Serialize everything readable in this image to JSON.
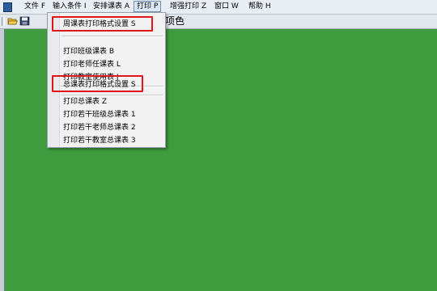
{
  "menubar": {
    "items": [
      {
        "label": "文件 F"
      },
      {
        "label": "输入条件 I"
      },
      {
        "label": "安排课表 A"
      },
      {
        "label": "打印 P"
      },
      {
        "label": "增强打印 Z"
      },
      {
        "label": "窗口 W"
      },
      {
        "label": "帮助 H"
      }
    ],
    "active_index": 3
  },
  "toolbar": {
    "buttons": [
      {
        "icon": "open-folder-icon"
      },
      {
        "icon": "save-disk-icon"
      }
    ],
    "visible_text": "项色"
  },
  "print_menu": {
    "groups": [
      {
        "items": [
          {
            "label": "周课表打印格式设置 S",
            "highlighted": true
          }
        ]
      },
      {
        "items": [
          {
            "label": "打印班级课表 B"
          },
          {
            "label": "打印老师任课表 L"
          },
          {
            "label": "打印教室使用表 J"
          }
        ]
      },
      {
        "items": [
          {
            "label": "总课表打印格式设置 S",
            "highlighted": true
          }
        ]
      },
      {
        "items": [
          {
            "label": "打印总课表 Z"
          },
          {
            "label": "打印若干班级总课表 1"
          },
          {
            "label": "打印若干老师总课表 2"
          },
          {
            "label": "打印若干教室总课表 3"
          }
        ]
      }
    ]
  },
  "annotation_color": "#e0161a",
  "workspace_color": "#3e9c3e"
}
